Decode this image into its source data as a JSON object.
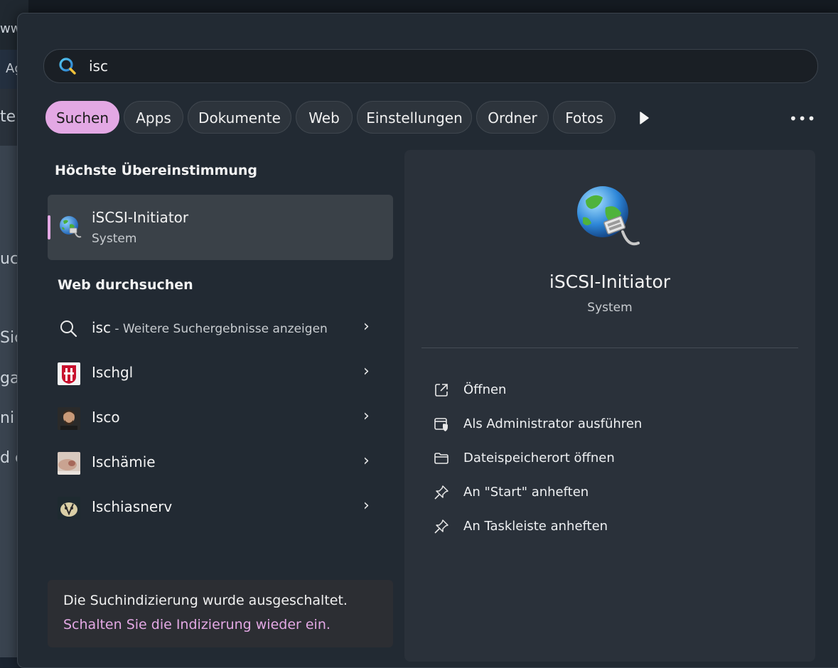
{
  "background": {
    "fragments": [
      "www",
      "Ag",
      "tel",
      "uc",
      "Sic",
      "ga",
      "ni",
      "d c"
    ]
  },
  "search": {
    "query": "isc",
    "icon": "search-icon"
  },
  "filters": [
    {
      "label": "Suchen",
      "active": true
    },
    {
      "label": "Apps",
      "active": false
    },
    {
      "label": "Dokumente",
      "active": false
    },
    {
      "label": "Web",
      "active": false
    },
    {
      "label": "Einstellungen",
      "active": false
    },
    {
      "label": "Ordner",
      "active": false
    },
    {
      "label": "Fotos",
      "active": false
    }
  ],
  "best_match": {
    "section_title": "Höchste Übereinstimmung",
    "name": "iSCSI-Initiator",
    "subtitle": "System",
    "icon": "globe-network-icon"
  },
  "web": {
    "section_title": "Web durchsuchen",
    "items": [
      {
        "label": "isc",
        "hint": " - Weitere Suchergebnisse anzeigen",
        "icon": "search-icon"
      },
      {
        "label": "Ischgl",
        "hint": "",
        "icon": "ischgl-crest-thumbnail"
      },
      {
        "label": "Isco",
        "hint": "",
        "icon": "isco-photo-thumbnail"
      },
      {
        "label": "Ischämie",
        "hint": "",
        "icon": "ischaemie-photo-thumbnail"
      },
      {
        "label": "Ischiasnerv",
        "hint": "",
        "icon": "ischiasnerv-illustration-thumbnail"
      }
    ]
  },
  "notice": {
    "text": "Die Suchindizierung wurde ausgeschaltet.",
    "link": "Schalten Sie die Indizierung wieder ein."
  },
  "detail": {
    "title": "iSCSI-Initiator",
    "subtitle": "System",
    "actions": [
      {
        "label": "Öffnen",
        "icon": "open-external-icon"
      },
      {
        "label": "Als Administrator ausführen",
        "icon": "admin-shield-icon"
      },
      {
        "label": "Dateispeicherort öffnen",
        "icon": "folder-icon"
      },
      {
        "label": "An \"Start\" anheften",
        "icon": "pin-icon"
      },
      {
        "label": "An Taskleiste anheften",
        "icon": "pin-icon"
      }
    ]
  },
  "colors": {
    "accent": "#e3a8e4",
    "panel": "#222a33",
    "detail_panel": "#2a313a"
  }
}
